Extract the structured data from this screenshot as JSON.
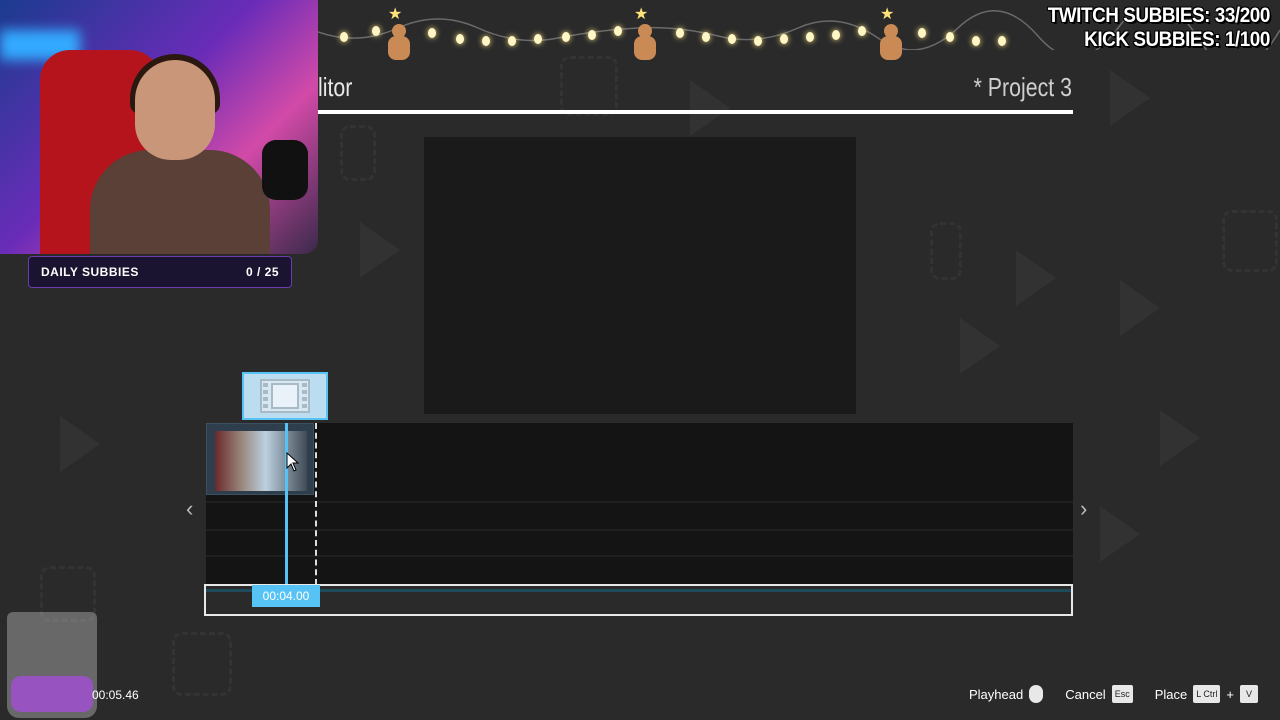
{
  "overlay": {
    "daily_label": "DAILY SUBBIES",
    "daily_count": "0 / 25",
    "twitch_counter": "TWITCH SUBBIES: 33/200",
    "kick_counter": "KICK SUBBIES: 1/100"
  },
  "editor": {
    "title": "litor",
    "project_name": "* Project 3",
    "playhead_time": "00:04.00",
    "total_time": "00:05.46"
  },
  "hints": {
    "playhead_label": "Playhead",
    "cancel_label": "Cancel",
    "cancel_key": "Esc",
    "place_label": "Place",
    "place_key": "L Ctrl",
    "plus": "+",
    "v_key": "V"
  },
  "colors": {
    "accent": "#57c3f5",
    "background": "#2a2a2a",
    "timeline": "#141414"
  },
  "icons": {
    "prev": "chevron-left-icon",
    "next": "chevron-right-icon",
    "film": "film-strip-icon",
    "mouse": "mouse-icon"
  }
}
